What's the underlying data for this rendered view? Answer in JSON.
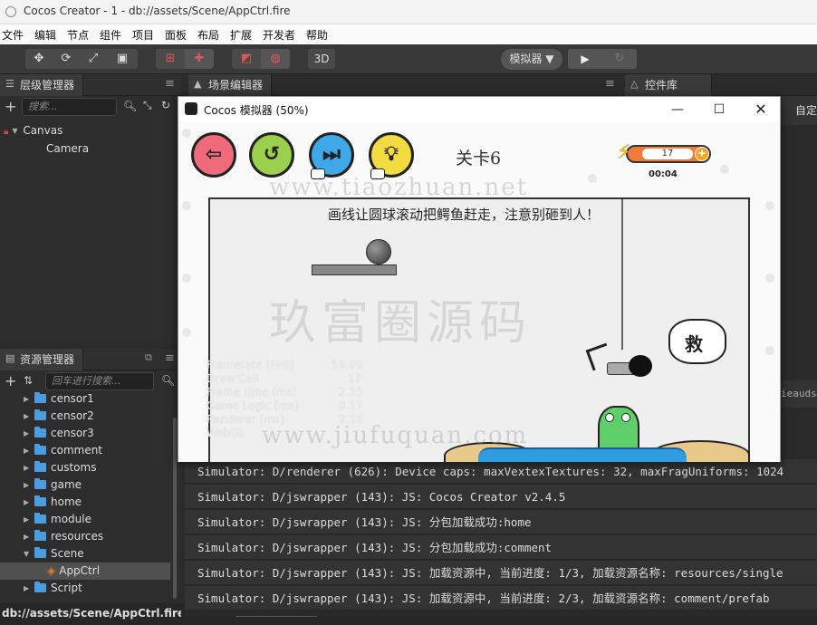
{
  "app": {
    "title": "Cocos Creator - 1 - db://assets/Scene/AppCtrl.fire"
  },
  "menu": [
    "文件",
    "编辑",
    "节点",
    "组件",
    "项目",
    "面板",
    "布局",
    "扩展",
    "开发者",
    "帮助"
  ],
  "toolbar": {
    "simulator_label": "模拟器 ▼",
    "mode_3d": "3D"
  },
  "hierarchy": {
    "tab_label": "层级管理器",
    "search_placeholder": "搜索...",
    "nodes": [
      "Canvas",
      "Camera"
    ]
  },
  "scene_editor": {
    "tab_label": "场景编辑器"
  },
  "widgets": {
    "tab_label": "控件库"
  },
  "right_clip": {
    "label": "自定"
  },
  "assets": {
    "tab_label": "资源管理器",
    "search_placeholder": "回车进行搜索...",
    "items": [
      "censor1",
      "censor2",
      "censor3",
      "comment",
      "customs",
      "game",
      "home",
      "module",
      "resources",
      "Scene",
      "AppCtrl",
      "Script"
    ]
  },
  "status": {
    "path": "db://assets/Scene/AppCtrl.fire"
  },
  "console": {
    "partial_top": "ieaudsi",
    "lines": [
      "Simulator: D/renderer (626): Device caps: maxVextexTextures: 32, maxFragUniforms: 1024",
      "Simulator: D/jswrapper (143): JS: Cocos Creator v2.4.5",
      "Simulator: D/jswrapper (143): JS: 分包加载成功:home",
      "Simulator: D/jswrapper (143): JS: 分包加载成功:comment",
      "Simulator: D/jswrapper (143): JS: 加载资源中, 当前进度: 1/3, 加载资源名称: resources/single",
      "Simulator: D/jswrapper (143): JS: 加载资源中, 当前进度: 2/3, 加载资源名称: comment/prefab"
    ]
  },
  "simulator": {
    "title": "Cocos 模拟器 (50%)",
    "level_label": "关卡6",
    "energy": "17",
    "timer": "00:04",
    "hint": "画线让圆球滚动把鳄鱼赶走，注意别砸到人！",
    "help_bubble": "救",
    "watermarks": [
      "www.tiaozhuan.net",
      "玖富圈源码",
      "www.jiufuquan.com"
    ],
    "stats_labels": [
      "Framerate (FPS)",
      "Draw Call",
      "Frame time (ms)",
      "Game Logic (ms)",
      "Renderer (ms)",
      "WebGL"
    ],
    "stats_values": [
      "59.99",
      "17",
      "2.33",
      "0.17",
      "2.16",
      ""
    ]
  }
}
